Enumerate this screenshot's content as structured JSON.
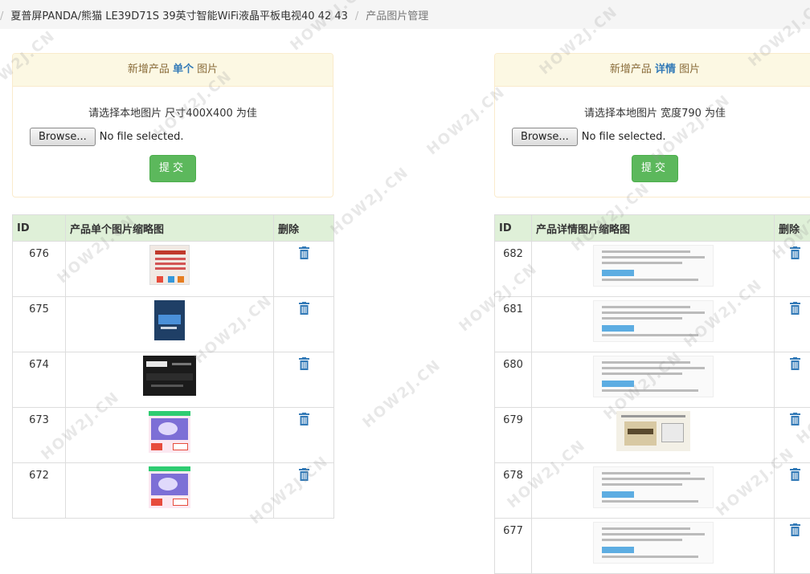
{
  "breadcrumb": {
    "separator": "/",
    "product": "夏普屏PANDA/熊猫 LE39D71S 39英寸智能WiFi液晶平板电视40 42 43",
    "current": "产品图片管理"
  },
  "panel_single": {
    "title_prefix": "新增产品",
    "title_highlight": "单个",
    "title_suffix": "图片",
    "hint": "请选择本地图片 尺寸400X400 为佳",
    "browse_label": "Browse...",
    "no_file": "No file selected.",
    "submit_label": "提交"
  },
  "panel_detail": {
    "title_prefix": "新增产品",
    "title_highlight": "详情",
    "title_suffix": "图片",
    "hint": "请选择本地图片 宽度790 为佳",
    "browse_label": "Browse...",
    "no_file": "No file selected.",
    "submit_label": "提交"
  },
  "table_single": {
    "headers": {
      "id": "ID",
      "thumb": "产品单个图片缩略图",
      "delete": "删除"
    },
    "rows": [
      {
        "id": "676",
        "thumb": "poster-red"
      },
      {
        "id": "675",
        "thumb": "box-blue"
      },
      {
        "id": "674",
        "thumb": "remote-dark"
      },
      {
        "id": "673",
        "thumb": "tv-promo"
      },
      {
        "id": "672",
        "thumb": "tv-promo"
      }
    ]
  },
  "table_detail": {
    "headers": {
      "id": "ID",
      "thumb": "产品详情图片缩略图",
      "delete": "删除"
    },
    "rows": [
      {
        "id": "682",
        "thumb": "detail-text"
      },
      {
        "id": "681",
        "thumb": "detail-text"
      },
      {
        "id": "680",
        "thumb": "detail-text"
      },
      {
        "id": "679",
        "thumb": "detail-box"
      },
      {
        "id": "678",
        "thumb": "detail-text"
      },
      {
        "id": "677",
        "thumb": "detail-text"
      }
    ]
  },
  "icons": {
    "delete": "trash-icon"
  },
  "watermark": "HOW2J.CN",
  "colors": {
    "panel_header_bg": "#fcf8e3",
    "panel_header_text": "#8a6d3b",
    "highlight": "#337ab7",
    "submit_bg": "#5cb85c",
    "table_header_bg": "#dff0d8",
    "trash_icon": "#337ab7"
  }
}
